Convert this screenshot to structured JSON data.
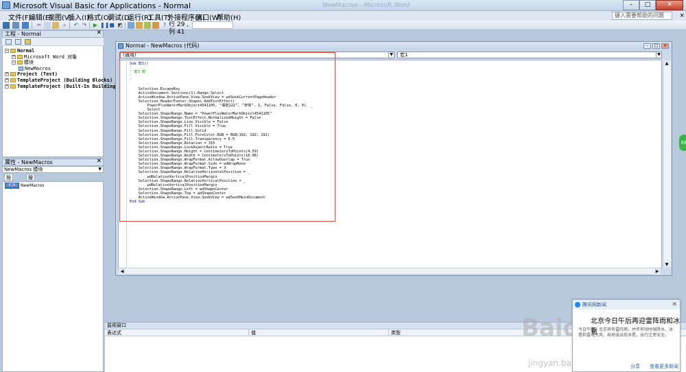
{
  "window": {
    "title": "Microsoft Visual Basic for Applications - Normal",
    "ghost_title": "NewMacros - Microsoft Word",
    "min": "–",
    "max": "□",
    "close": "✕"
  },
  "menu": {
    "items": [
      "文件(F)",
      "编辑(E)",
      "视图(V)",
      "插入(I)",
      "格式(O)",
      "调试(D)",
      "运行(R)",
      "工具(T)",
      "外接程序(A)",
      "窗口(W)",
      "帮助(H)"
    ],
    "help_placeholder": "键入需要帮助的问题"
  },
  "toolbar": {
    "position_label": "行 29 , 列 41"
  },
  "project": {
    "title": "工程 - Normal",
    "close": "✕",
    "tree": [
      {
        "indent": 0,
        "exp": "−",
        "icon": "project",
        "label": "Normal",
        "bold": true
      },
      {
        "indent": 1,
        "exp": "+",
        "icon": "folder",
        "label": "Microsoft Word 对象",
        "bold": false
      },
      {
        "indent": 1,
        "exp": "−",
        "icon": "folder",
        "label": "模块",
        "bold": false
      },
      {
        "indent": 2,
        "exp": "",
        "icon": "module",
        "label": "NewMacros",
        "bold": false
      },
      {
        "indent": 0,
        "exp": "+",
        "icon": "project",
        "label": "Project (Test)",
        "bold": true
      },
      {
        "indent": 0,
        "exp": "+",
        "icon": "project",
        "label": "TemplateProject (Building Blocks)",
        "bold": true
      },
      {
        "indent": 0,
        "exp": "+",
        "icon": "project",
        "label": "TemplateProject (Built-In Building",
        "bold": true
      }
    ]
  },
  "properties": {
    "title": "属性 - NewMacros",
    "close": "✕",
    "object": "NewMacros 模块",
    "tabs": [
      "按字母序",
      "按分类序"
    ],
    "row_name": "(名称)",
    "row_value": "NewMacros"
  },
  "code_window": {
    "title": "Normal - NewMacros (代码)",
    "object_combo": "(通用)",
    "proc_combo": "宏1",
    "lines": [
      {
        "t": "Sub 宏1()",
        "c": "kw"
      },
      {
        "t": "'",
        "c": "cm"
      },
      {
        "t": "' 宏1 宏",
        "c": "cm"
      },
      {
        "t": "'",
        "c": "cm"
      },
      {
        "t": "'",
        "c": "cm"
      },
      {
        "t": "",
        "c": ""
      },
      {
        "t": "    Selection.EscapeKey",
        "c": ""
      },
      {
        "t": "    ActiveDocument.Sections(1).Range.Select",
        "c": ""
      },
      {
        "t": "    ActiveWindow.ActivePane.View.SeekView = wdSeekCurrentPageHeader",
        "c": ""
      },
      {
        "t": "    Selection.HeaderFooter.Shapes.AddTextEffect( _",
        "c": ""
      },
      {
        "t": "        PowerPlusWaterMarkObject4541105, \"保密222\", \"宋体\", 1, False, False, 0, 0). _",
        "c": ""
      },
      {
        "t": "        Select",
        "c": ""
      },
      {
        "t": "    Selection.ShapeRange.Name = \"PowerPlusWaterMarkObject4541105\"",
        "c": ""
      },
      {
        "t": "    Selection.ShapeRange.TextEffect.NormalizedHeight = False",
        "c": ""
      },
      {
        "t": "    Selection.ShapeRange.Line.Visible = False",
        "c": ""
      },
      {
        "t": "    Selection.ShapeRange.Fill.Visible = True",
        "c": ""
      },
      {
        "t": "    Selection.ShapeRange.Fill.Solid",
        "c": ""
      },
      {
        "t": "    Selection.ShapeRange.Fill.ForeColor.RGB = RGB(192, 192, 192)",
        "c": ""
      },
      {
        "t": "    Selection.ShapeRange.Fill.Transparency = 0.5",
        "c": ""
      },
      {
        "t": "    Selection.ShapeRange.Rotation = 315",
        "c": ""
      },
      {
        "t": "    Selection.ShapeRange.LockAspectRatio = True",
        "c": ""
      },
      {
        "t": "    Selection.ShapeRange.Height = CentimetersToPoints(4.59)",
        "c": ""
      },
      {
        "t": "    Selection.ShapeRange.Width = CentimetersToPoints(16.06)",
        "c": ""
      },
      {
        "t": "    Selection.ShapeRange.WrapFormat.AllowOverlap = True",
        "c": ""
      },
      {
        "t": "    Selection.ShapeRange.WrapFormat.Side = wdWrapNone",
        "c": ""
      },
      {
        "t": "    Selection.ShapeRange.WrapFormat.Type = 3",
        "c": ""
      },
      {
        "t": "    Selection.ShapeRange.RelativeHorizontalPosition = _",
        "c": ""
      },
      {
        "t": "        wdRelativeVerticalPositionMargin",
        "c": ""
      },
      {
        "t": "    Selection.ShapeRange.RelativeVerticalPosition = _",
        "c": ""
      },
      {
        "t": "        wdRelativeVerticalPositionMargin",
        "c": ""
      },
      {
        "t": "    Selection.ShapeRange.Left = wdShapeCenter",
        "c": ""
      },
      {
        "t": "    Selection.ShapeRange.Top = wdShapeCenter",
        "c": ""
      },
      {
        "t": "    ActiveWindow.ActivePane.View.SeekView = wdSeekMainDocument",
        "c": ""
      },
      {
        "t": "End Sub",
        "c": "kw"
      }
    ]
  },
  "watch": {
    "title": "监视窗口",
    "columns": [
      "表达式",
      "值",
      "类型"
    ]
  },
  "notification": {
    "header": "腾讯网新闻",
    "close": "✕",
    "title": "北京今日午后再迎雷阵雨和冰雹",
    "body": "今日午后，北京将有雷阵雨，并伴有短时强降水、冰雹和雷电大风，局地或出现冰雹，出行注意安全。",
    "share": "分享",
    "more": "查看更多新闻"
  },
  "watermark": {
    "logo": "Baidu 经验",
    "url": "jingyan.baidu.com"
  },
  "side_badge": "68",
  "colors": {
    "keyword": "#00008b",
    "comment": "#007a00",
    "highlight": "#e0453a"
  }
}
